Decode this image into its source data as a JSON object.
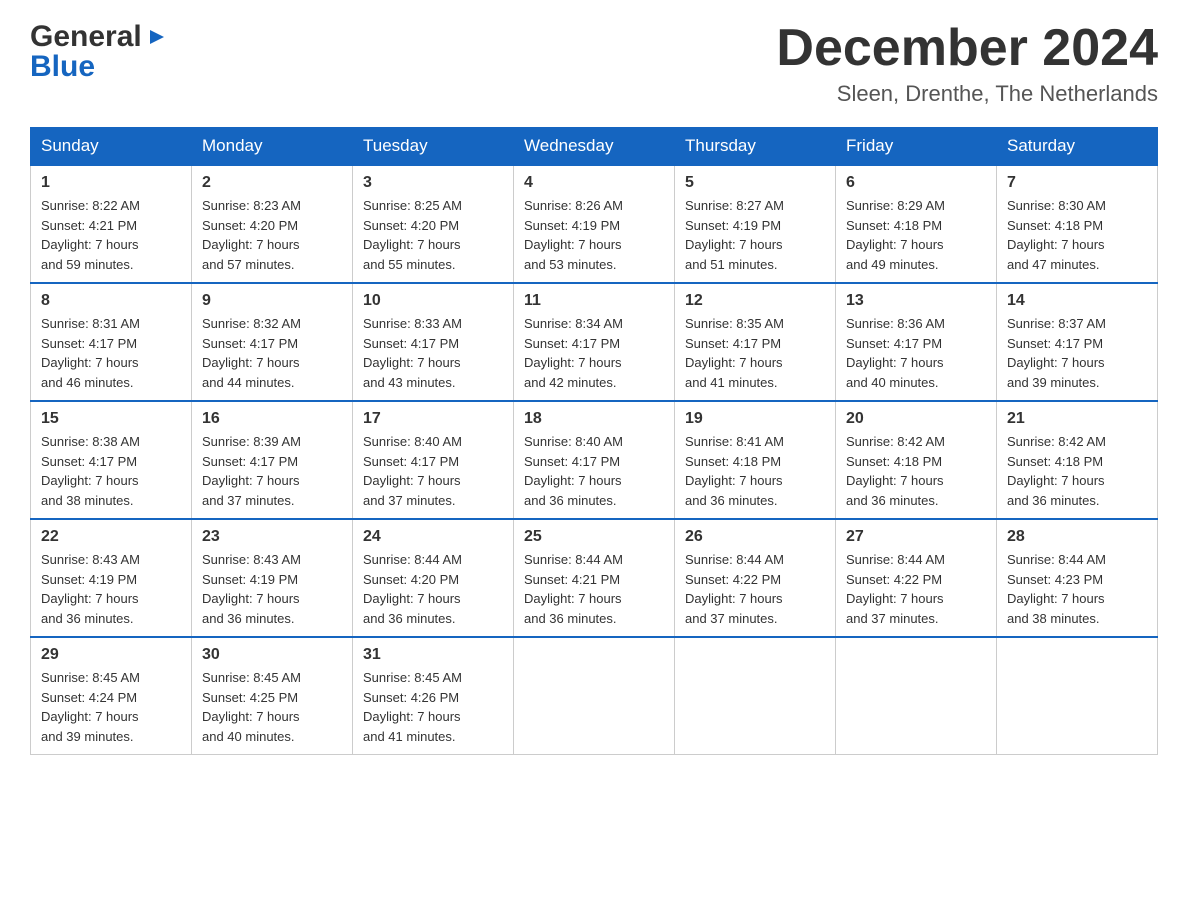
{
  "header": {
    "logo_general": "General",
    "logo_blue": "Blue",
    "month_title": "December 2024",
    "location": "Sleen, Drenthe, The Netherlands"
  },
  "weekdays": [
    "Sunday",
    "Monday",
    "Tuesday",
    "Wednesday",
    "Thursday",
    "Friday",
    "Saturday"
  ],
  "weeks": [
    [
      {
        "day": "1",
        "sunrise": "8:22 AM",
        "sunset": "4:21 PM",
        "daylight": "7 hours and 59 minutes."
      },
      {
        "day": "2",
        "sunrise": "8:23 AM",
        "sunset": "4:20 PM",
        "daylight": "7 hours and 57 minutes."
      },
      {
        "day": "3",
        "sunrise": "8:25 AM",
        "sunset": "4:20 PM",
        "daylight": "7 hours and 55 minutes."
      },
      {
        "day": "4",
        "sunrise": "8:26 AM",
        "sunset": "4:19 PM",
        "daylight": "7 hours and 53 minutes."
      },
      {
        "day": "5",
        "sunrise": "8:27 AM",
        "sunset": "4:19 PM",
        "daylight": "7 hours and 51 minutes."
      },
      {
        "day": "6",
        "sunrise": "8:29 AM",
        "sunset": "4:18 PM",
        "daylight": "7 hours and 49 minutes."
      },
      {
        "day": "7",
        "sunrise": "8:30 AM",
        "sunset": "4:18 PM",
        "daylight": "7 hours and 47 minutes."
      }
    ],
    [
      {
        "day": "8",
        "sunrise": "8:31 AM",
        "sunset": "4:17 PM",
        "daylight": "7 hours and 46 minutes."
      },
      {
        "day": "9",
        "sunrise": "8:32 AM",
        "sunset": "4:17 PM",
        "daylight": "7 hours and 44 minutes."
      },
      {
        "day": "10",
        "sunrise": "8:33 AM",
        "sunset": "4:17 PM",
        "daylight": "7 hours and 43 minutes."
      },
      {
        "day": "11",
        "sunrise": "8:34 AM",
        "sunset": "4:17 PM",
        "daylight": "7 hours and 42 minutes."
      },
      {
        "day": "12",
        "sunrise": "8:35 AM",
        "sunset": "4:17 PM",
        "daylight": "7 hours and 41 minutes."
      },
      {
        "day": "13",
        "sunrise": "8:36 AM",
        "sunset": "4:17 PM",
        "daylight": "7 hours and 40 minutes."
      },
      {
        "day": "14",
        "sunrise": "8:37 AM",
        "sunset": "4:17 PM",
        "daylight": "7 hours and 39 minutes."
      }
    ],
    [
      {
        "day": "15",
        "sunrise": "8:38 AM",
        "sunset": "4:17 PM",
        "daylight": "7 hours and 38 minutes."
      },
      {
        "day": "16",
        "sunrise": "8:39 AM",
        "sunset": "4:17 PM",
        "daylight": "7 hours and 37 minutes."
      },
      {
        "day": "17",
        "sunrise": "8:40 AM",
        "sunset": "4:17 PM",
        "daylight": "7 hours and 37 minutes."
      },
      {
        "day": "18",
        "sunrise": "8:40 AM",
        "sunset": "4:17 PM",
        "daylight": "7 hours and 36 minutes."
      },
      {
        "day": "19",
        "sunrise": "8:41 AM",
        "sunset": "4:18 PM",
        "daylight": "7 hours and 36 minutes."
      },
      {
        "day": "20",
        "sunrise": "8:42 AM",
        "sunset": "4:18 PM",
        "daylight": "7 hours and 36 minutes."
      },
      {
        "day": "21",
        "sunrise": "8:42 AM",
        "sunset": "4:18 PM",
        "daylight": "7 hours and 36 minutes."
      }
    ],
    [
      {
        "day": "22",
        "sunrise": "8:43 AM",
        "sunset": "4:19 PM",
        "daylight": "7 hours and 36 minutes."
      },
      {
        "day": "23",
        "sunrise": "8:43 AM",
        "sunset": "4:19 PM",
        "daylight": "7 hours and 36 minutes."
      },
      {
        "day": "24",
        "sunrise": "8:44 AM",
        "sunset": "4:20 PM",
        "daylight": "7 hours and 36 minutes."
      },
      {
        "day": "25",
        "sunrise": "8:44 AM",
        "sunset": "4:21 PM",
        "daylight": "7 hours and 36 minutes."
      },
      {
        "day": "26",
        "sunrise": "8:44 AM",
        "sunset": "4:22 PM",
        "daylight": "7 hours and 37 minutes."
      },
      {
        "day": "27",
        "sunrise": "8:44 AM",
        "sunset": "4:22 PM",
        "daylight": "7 hours and 37 minutes."
      },
      {
        "day": "28",
        "sunrise": "8:44 AM",
        "sunset": "4:23 PM",
        "daylight": "7 hours and 38 minutes."
      }
    ],
    [
      {
        "day": "29",
        "sunrise": "8:45 AM",
        "sunset": "4:24 PM",
        "daylight": "7 hours and 39 minutes."
      },
      {
        "day": "30",
        "sunrise": "8:45 AM",
        "sunset": "4:25 PM",
        "daylight": "7 hours and 40 minutes."
      },
      {
        "day": "31",
        "sunrise": "8:45 AM",
        "sunset": "4:26 PM",
        "daylight": "7 hours and 41 minutes."
      },
      null,
      null,
      null,
      null
    ]
  ],
  "labels": {
    "sunrise": "Sunrise:",
    "sunset": "Sunset:",
    "daylight": "Daylight:"
  }
}
